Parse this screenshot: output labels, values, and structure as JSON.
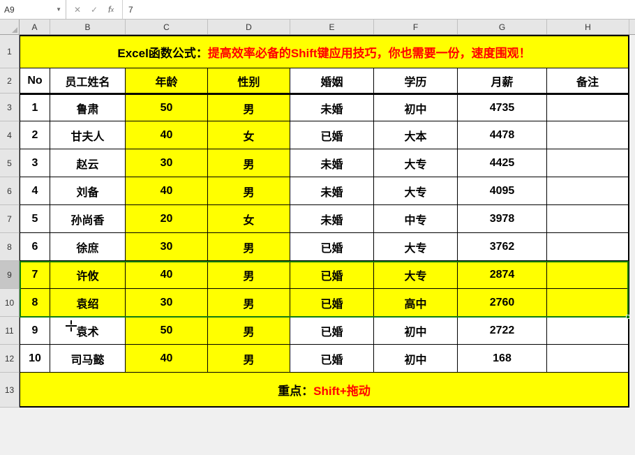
{
  "formula_bar": {
    "name_box": "A9",
    "cancel_glyph": "✕",
    "confirm_glyph": "✓",
    "fx_glyph": "fx",
    "value": "7"
  },
  "columns": [
    "A",
    "B",
    "C",
    "D",
    "E",
    "F",
    "G",
    "H"
  ],
  "rows": [
    "1",
    "2",
    "3",
    "4",
    "5",
    "6",
    "7",
    "8",
    "9",
    "10",
    "11",
    "12",
    "13"
  ],
  "title": {
    "prefix": "Excel函数公式：",
    "suffix": "提高效率必备的Shift键应用技巧，你也需要一份，速度围观！"
  },
  "headers": [
    "No",
    "员工姓名",
    "年龄",
    "性别",
    "婚姻",
    "学历",
    "月薪",
    "备注"
  ],
  "data": [
    {
      "no": "1",
      "name": "鲁肃",
      "age": "50",
      "sex": "男",
      "marriage": "未婚",
      "edu": "初中",
      "salary": "4735",
      "note": ""
    },
    {
      "no": "2",
      "name": "甘夫人",
      "age": "40",
      "sex": "女",
      "marriage": "已婚",
      "edu": "大本",
      "salary": "4478",
      "note": ""
    },
    {
      "no": "3",
      "name": "赵云",
      "age": "30",
      "sex": "男",
      "marriage": "未婚",
      "edu": "大专",
      "salary": "4425",
      "note": ""
    },
    {
      "no": "4",
      "name": "刘备",
      "age": "40",
      "sex": "男",
      "marriage": "未婚",
      "edu": "大专",
      "salary": "4095",
      "note": ""
    },
    {
      "no": "5",
      "name": "孙尚香",
      "age": "20",
      "sex": "女",
      "marriage": "未婚",
      "edu": "中专",
      "salary": "3978",
      "note": ""
    },
    {
      "no": "6",
      "name": "徐庶",
      "age": "30",
      "sex": "男",
      "marriage": "已婚",
      "edu": "大专",
      "salary": "3762",
      "note": ""
    },
    {
      "no": "7",
      "name": "许攸",
      "age": "40",
      "sex": "男",
      "marriage": "已婚",
      "edu": "大专",
      "salary": "2874",
      "note": ""
    },
    {
      "no": "8",
      "name": "袁绍",
      "age": "30",
      "sex": "男",
      "marriage": "已婚",
      "edu": "高中",
      "salary": "2760",
      "note": ""
    },
    {
      "no": "9",
      "name": "袁术",
      "age": "50",
      "sex": "男",
      "marriage": "已婚",
      "edu": "初中",
      "salary": "2722",
      "note": ""
    },
    {
      "no": "10",
      "name": "司马懿",
      "age": "40",
      "sex": "男",
      "marriage": "已婚",
      "edu": "初中",
      "salary": "168",
      "note": ""
    }
  ],
  "footer": {
    "prefix": "重点：",
    "suffix": "Shift+拖动"
  },
  "selection": {
    "selected_data_rows": [
      6,
      7
    ],
    "row_header_selected": 8
  },
  "chart_data": {
    "type": "table",
    "title": "Excel函数公式：提高效率必备的Shift键应用技巧，你也需要一份，速度围观！",
    "columns": [
      "No",
      "员工姓名",
      "年龄",
      "性别",
      "婚姻",
      "学历",
      "月薪",
      "备注"
    ],
    "rows": [
      [
        1,
        "鲁肃",
        50,
        "男",
        "未婚",
        "初中",
        4735,
        ""
      ],
      [
        2,
        "甘夫人",
        40,
        "女",
        "已婚",
        "大本",
        4478,
        ""
      ],
      [
        3,
        "赵云",
        30,
        "男",
        "未婚",
        "大专",
        4425,
        ""
      ],
      [
        4,
        "刘备",
        40,
        "男",
        "未婚",
        "大专",
        4095,
        ""
      ],
      [
        5,
        "孙尚香",
        20,
        "女",
        "未婚",
        "中专",
        3978,
        ""
      ],
      [
        6,
        "徐庶",
        30,
        "男",
        "已婚",
        "大专",
        3762,
        ""
      ],
      [
        7,
        "许攸",
        40,
        "男",
        "已婚",
        "大专",
        2874,
        ""
      ],
      [
        8,
        "袁绍",
        30,
        "男",
        "已婚",
        "高中",
        2760,
        ""
      ],
      [
        9,
        "袁术",
        50,
        "男",
        "已婚",
        "初中",
        2722,
        ""
      ],
      [
        10,
        "司马懿",
        40,
        "男",
        "已婚",
        "初中",
        168,
        ""
      ]
    ],
    "footer": "重点：Shift+拖动"
  }
}
